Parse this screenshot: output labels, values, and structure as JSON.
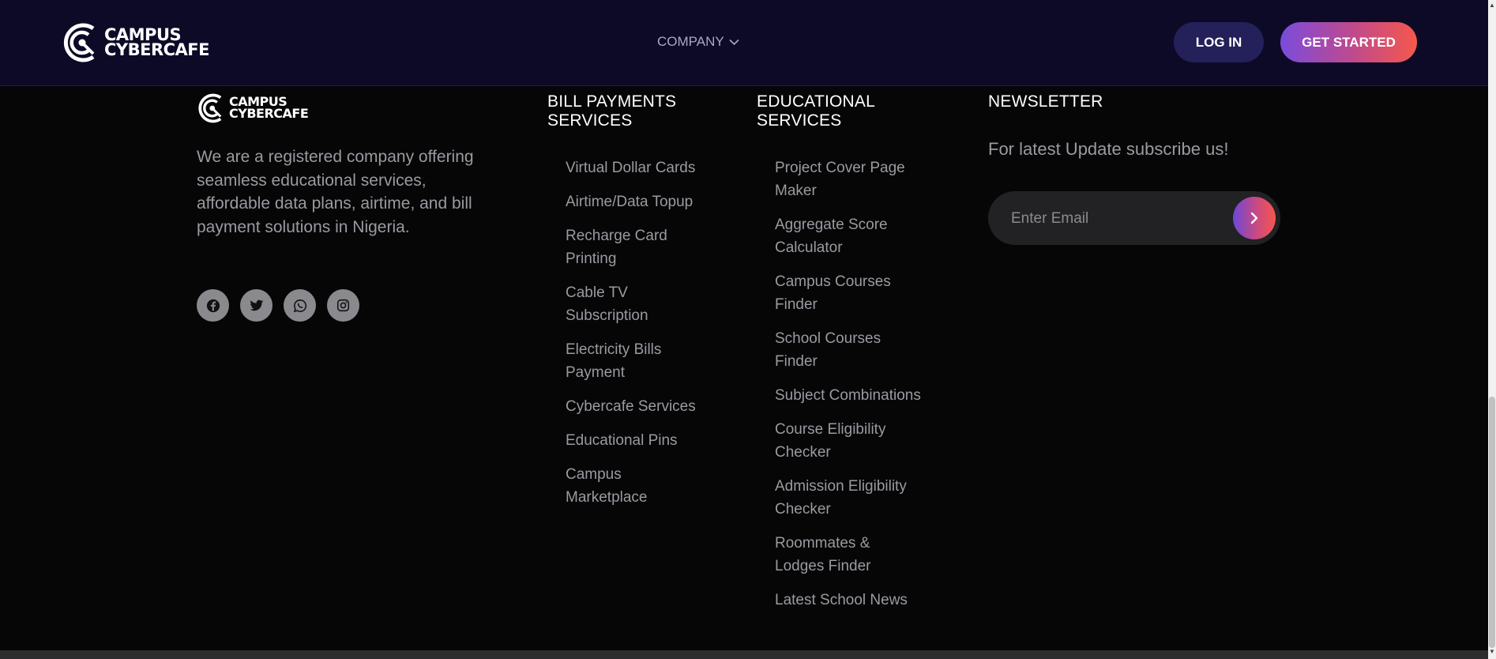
{
  "header": {
    "logo": {
      "line1": "CAMPUS",
      "line2": "CYBERCAFE"
    },
    "nav": {
      "company_label": "COMPANY"
    },
    "login_label": "LOG IN",
    "get_started_label": "GET STARTED"
  },
  "footer": {
    "logo": {
      "line1": "CAMPUS",
      "line2": "CYBERCAFE"
    },
    "about": "We are a registered company offering seamless educational services, affordable data plans, airtime, and bill payment solutions in Nigeria.",
    "socials": [
      "facebook-icon",
      "twitter-icon",
      "whatsapp-icon",
      "instagram-icon"
    ],
    "bill_payments": {
      "title_line1": "BILL PAYMENTS",
      "title_line2": "SERVICES",
      "items": [
        "Virtual Dollar Cards",
        "Airtime/Data Topup",
        "Recharge Card Printing",
        "Cable TV Subscription",
        "Electricity Bills Payment",
        "Cybercafe Services",
        "Educational Pins",
        "Campus Marketplace"
      ]
    },
    "educational": {
      "title_line1": "EDUCATIONAL",
      "title_line2": "SERVICES",
      "items": [
        "Project Cover Page Maker",
        "Aggregate Score Calculator",
        "Campus Courses Finder",
        "School Courses Finder",
        "Subject Combinations",
        "Course Eligibility Checker",
        "Admission Eligibility Checker",
        "Roommates & Lodges Finder",
        "Latest School News"
      ]
    },
    "newsletter": {
      "title": "NEWSLETTER",
      "text": "For latest Update subscribe us!",
      "email_placeholder": "Enter Email"
    }
  },
  "colors": {
    "header_bg": "#0d0a27",
    "page_bg": "#060606",
    "login_bg": "#24205a",
    "gradient_start": "#7a4bdc",
    "gradient_end": "#f5584c"
  }
}
